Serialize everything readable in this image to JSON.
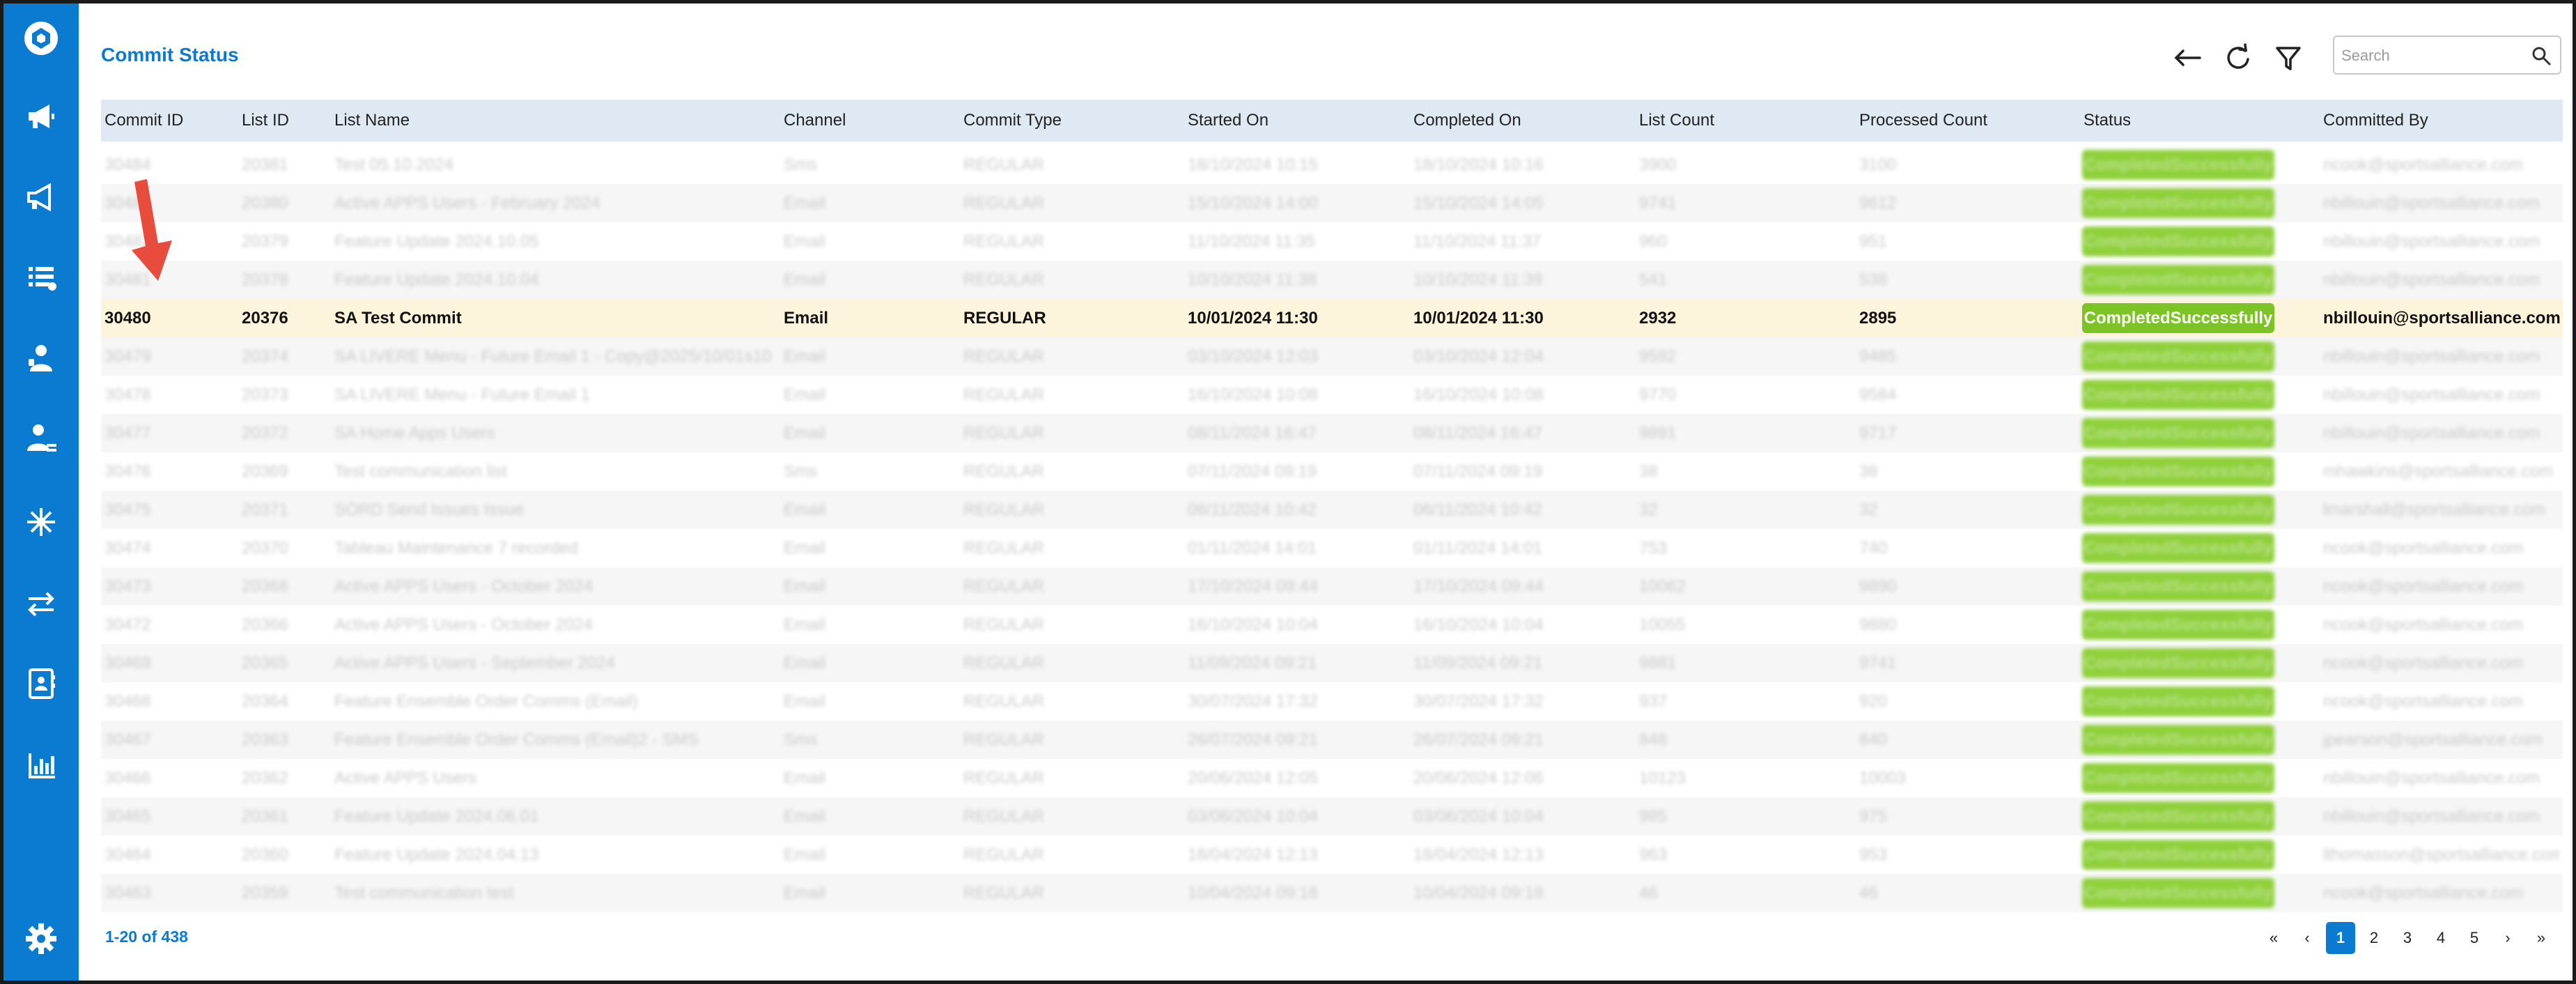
{
  "header": {
    "title": "Commit Status",
    "search_placeholder": "Search"
  },
  "icons": {
    "sidebar": [
      "logo-icon",
      "megaphone-icon",
      "megaphone-outline-icon",
      "list-icon",
      "person-icon",
      "person-list-icon",
      "snowflake-icon",
      "transfer-icon",
      "contact-book-icon",
      "chart-icon",
      "settings-icon"
    ],
    "header": [
      "back-arrow-icon",
      "refresh-icon",
      "filter-icon",
      "search-icon"
    ]
  },
  "colors": {
    "brand": "#0b7ad1",
    "status_success": "#7cc425",
    "highlight_row": "#fdf4dc",
    "header_row": "#dfe9f3",
    "annotation_arrow": "#e84c3d"
  },
  "table": {
    "columns": [
      "Commit ID",
      "List ID",
      "List Name",
      "Channel",
      "Commit Type",
      "Started On",
      "Completed On",
      "List Count",
      "Processed Count",
      "Status",
      "Committed By"
    ],
    "rows": [
      {
        "commit_id": "30484",
        "list_id": "20381",
        "list_name": "Test 05.10.2024",
        "channel": "Sms",
        "commit_type": "REGULAR",
        "started_on": "18/10/2024 10:15",
        "completed_on": "18/10/2024 10:16",
        "list_count": "3900",
        "processed_count": "3100",
        "status": "CompletedSuccessfully",
        "committed_by": "ncook@sportsalliance.com",
        "blurred": true
      },
      {
        "commit_id": "30483",
        "list_id": "20380",
        "list_name": "Active APPS Users - February 2024",
        "channel": "Email",
        "commit_type": "REGULAR",
        "started_on": "15/10/2024 14:00",
        "completed_on": "15/10/2024 14:05",
        "list_count": "9741",
        "processed_count": "9612",
        "status": "CompletedSuccessfully",
        "committed_by": "nbillouin@sportsalliance.com",
        "blurred": true
      },
      {
        "commit_id": "30482",
        "list_id": "20379",
        "list_name": "Feature Update 2024.10.05",
        "channel": "Email",
        "commit_type": "REGULAR",
        "started_on": "11/10/2024 11:35",
        "completed_on": "11/10/2024 11:37",
        "list_count": "960",
        "processed_count": "951",
        "status": "CompletedSuccessfully",
        "committed_by": "nbillouin@sportsalliance.com",
        "blurred": true
      },
      {
        "commit_id": "30481",
        "list_id": "20378",
        "list_name": "Feature Update 2024.10.04",
        "channel": "Email",
        "commit_type": "REGULAR",
        "started_on": "10/10/2024 11:38",
        "completed_on": "10/10/2024 11:39",
        "list_count": "541",
        "processed_count": "538",
        "status": "CompletedSuccessfully",
        "committed_by": "nbillouin@sportsalliance.com",
        "blurred": true
      },
      {
        "commit_id": "30480",
        "list_id": "20376",
        "list_name": "SA Test Commit",
        "channel": "Email",
        "commit_type": "REGULAR",
        "started_on": "10/01/2024 11:30",
        "completed_on": "10/01/2024 11:30",
        "list_count": "2932",
        "processed_count": "2895",
        "status": "CompletedSuccessfully",
        "committed_by": "nbillouin@sportsalliance.com",
        "blurred": false
      },
      {
        "commit_id": "30479",
        "list_id": "20374",
        "list_name": "SA LIVERE Menu - Future Email 1 - Copy@2025/10/01s10",
        "channel": "Email",
        "commit_type": "REGULAR",
        "started_on": "03/10/2024 12:03",
        "completed_on": "03/10/2024 12:04",
        "list_count": "9592",
        "processed_count": "9485",
        "status": "CompletedSuccessfully",
        "committed_by": "nbillouin@sportsalliance.com",
        "blurred": true
      },
      {
        "commit_id": "30478",
        "list_id": "20373",
        "list_name": "SA LIVERE Menu - Future Email 1",
        "channel": "Email",
        "commit_type": "REGULAR",
        "started_on": "16/10/2024 10:08",
        "completed_on": "16/10/2024 10:08",
        "list_count": "9770",
        "processed_count": "9584",
        "status": "CompletedSuccessfully",
        "committed_by": "nbillouin@sportsalliance.com",
        "blurred": true
      },
      {
        "commit_id": "30477",
        "list_id": "20372",
        "list_name": "SA Home Apps Users",
        "channel": "Email",
        "commit_type": "REGULAR",
        "started_on": "08/11/2024 16:47",
        "completed_on": "08/11/2024 16:47",
        "list_count": "9891",
        "processed_count": "9717",
        "status": "CompletedSuccessfully",
        "committed_by": "nbillouin@sportsalliance.com",
        "blurred": true
      },
      {
        "commit_id": "30476",
        "list_id": "20369",
        "list_name": "Test communication list",
        "channel": "Sms",
        "commit_type": "REGULAR",
        "started_on": "07/11/2024 09:19",
        "completed_on": "07/11/2024 09:19",
        "list_count": "38",
        "processed_count": "38",
        "status": "CompletedSuccessfully",
        "committed_by": "mhawkins@sportsalliance.com",
        "blurred": true
      },
      {
        "commit_id": "30475",
        "list_id": "20371",
        "list_name": "SORD Send Issues Issue",
        "channel": "Email",
        "commit_type": "REGULAR",
        "started_on": "06/11/2024 10:42",
        "completed_on": "06/11/2024 10:42",
        "list_count": "32",
        "processed_count": "32",
        "status": "CompletedSuccessfully",
        "committed_by": "lmarshall@sportsalliance.com",
        "blurred": true
      },
      {
        "commit_id": "30474",
        "list_id": "20370",
        "list_name": "Tableau Maintenance 7 recorded",
        "channel": "Email",
        "commit_type": "REGULAR",
        "started_on": "01/11/2024 14:01",
        "completed_on": "01/11/2024 14:01",
        "list_count": "753",
        "processed_count": "740",
        "status": "CompletedSuccessfully",
        "committed_by": "ncook@sportsalliance.com",
        "blurred": true
      },
      {
        "commit_id": "30473",
        "list_id": "20368",
        "list_name": "Active APPS Users - October 2024",
        "channel": "Email",
        "commit_type": "REGULAR",
        "started_on": "17/10/2024 09:44",
        "completed_on": "17/10/2024 09:44",
        "list_count": "10062",
        "processed_count": "9890",
        "status": "CompletedSuccessfully",
        "committed_by": "ncook@sportsalliance.com",
        "blurred": true
      },
      {
        "commit_id": "30472",
        "list_id": "20366",
        "list_name": "Active APPS Users - October 2024",
        "channel": "Email",
        "commit_type": "REGULAR",
        "started_on": "16/10/2024 10:04",
        "completed_on": "16/10/2024 10:04",
        "list_count": "10055",
        "processed_count": "9880",
        "status": "CompletedSuccessfully",
        "committed_by": "ncook@sportsalliance.com",
        "blurred": true
      },
      {
        "commit_id": "30469",
        "list_id": "20365",
        "list_name": "Active APPS Users - September 2024",
        "channel": "Email",
        "commit_type": "REGULAR",
        "started_on": "11/09/2024 09:21",
        "completed_on": "11/09/2024 09:21",
        "list_count": "9881",
        "processed_count": "9741",
        "status": "CompletedSuccessfully",
        "committed_by": "ncook@sportsalliance.com",
        "blurred": true
      },
      {
        "commit_id": "30468",
        "list_id": "20364",
        "list_name": "Feature Ensemble Order Comms (Email)",
        "channel": "Email",
        "commit_type": "REGULAR",
        "started_on": "30/07/2024 17:32",
        "completed_on": "30/07/2024 17:32",
        "list_count": "937",
        "processed_count": "920",
        "status": "CompletedSuccessfully",
        "committed_by": "ncook@sportsalliance.com",
        "blurred": true
      },
      {
        "commit_id": "30467",
        "list_id": "20363",
        "list_name": "Feature Ensemble Order Comms (Email)2 - SMS",
        "channel": "Sms",
        "commit_type": "REGULAR",
        "started_on": "26/07/2024 09:21",
        "completed_on": "26/07/2024 09:21",
        "list_count": "848",
        "processed_count": "840",
        "status": "CompletedSuccessfully",
        "committed_by": "jpearson@sportsalliance.com",
        "blurred": true
      },
      {
        "commit_id": "30466",
        "list_id": "20362",
        "list_name": "Active APPS Users",
        "channel": "Email",
        "commit_type": "REGULAR",
        "started_on": "20/06/2024 12:05",
        "completed_on": "20/06/2024 12:06",
        "list_count": "10123",
        "processed_count": "10003",
        "status": "CompletedSuccessfully",
        "committed_by": "nbillouin@sportsalliance.com",
        "blurred": true
      },
      {
        "commit_id": "30465",
        "list_id": "20361",
        "list_name": "Feature Update 2024.06.01",
        "channel": "Email",
        "commit_type": "REGULAR",
        "started_on": "03/06/2024 10:04",
        "completed_on": "03/06/2024 10:04",
        "list_count": "985",
        "processed_count": "975",
        "status": "CompletedSuccessfully",
        "committed_by": "nbillouin@sportsalliance.com",
        "blurred": true
      },
      {
        "commit_id": "30464",
        "list_id": "20360",
        "list_name": "Feature Update 2024.04.13",
        "channel": "Email",
        "commit_type": "REGULAR",
        "started_on": "18/04/2024 12:13",
        "completed_on": "18/04/2024 12:13",
        "list_count": "963",
        "processed_count": "953",
        "status": "CompletedSuccessfully",
        "committed_by": "lthomasson@sportsalliance.com",
        "blurred": true
      },
      {
        "commit_id": "30463",
        "list_id": "20359",
        "list_name": "Test communication test",
        "channel": "Email",
        "commit_type": "REGULAR",
        "started_on": "10/04/2024 09:18",
        "completed_on": "10/04/2024 09:18",
        "list_count": "46",
        "processed_count": "46",
        "status": "CompletedSuccessfully",
        "committed_by": "ncook@sportsalliance.com",
        "blurred": true
      }
    ]
  },
  "footer": {
    "range_text": "1-20 of 438",
    "pages": [
      "1",
      "2",
      "3",
      "4",
      "5"
    ],
    "active_page": "1",
    "first_label": "«",
    "prev_label": "‹",
    "next_label": "›",
    "last_label": "»"
  }
}
